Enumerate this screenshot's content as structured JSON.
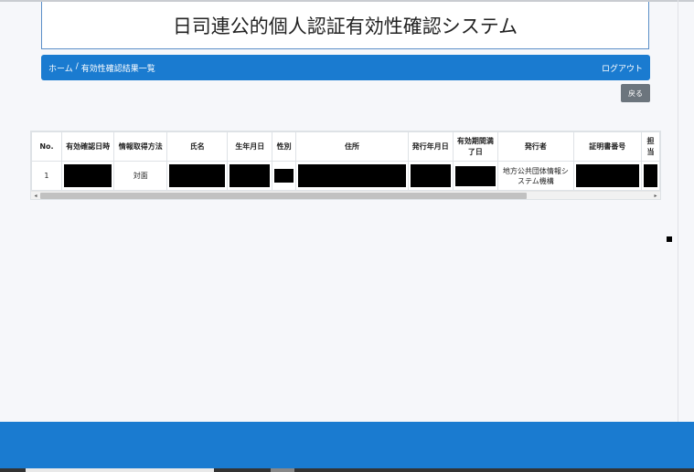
{
  "header": {
    "title": "日司連公的個人認証有効性確認システム"
  },
  "nav": {
    "breadcrumb_home": "ホーム",
    "breadcrumb_sep": "/",
    "breadcrumb_current": "有効性確認結果一覧",
    "logout": "ログアウト"
  },
  "toolbar": {
    "back_label": "戻る"
  },
  "table": {
    "columns": [
      "No.",
      "有効確認日時",
      "情報取得方法",
      "氏名",
      "生年月日",
      "性別",
      "住所",
      "発行年月日",
      "有効期間満了日",
      "発行者",
      "証明書番号",
      "担当"
    ],
    "rows": [
      {
        "no": "1",
        "method": "対面",
        "issuer": "地方公共団体情報システム機構"
      }
    ]
  },
  "scroll": {
    "left_arrow": "◂",
    "right_arrow": "▸"
  },
  "colors": {
    "primary": "#1a7bd0",
    "back_button": "#6c757d"
  }
}
